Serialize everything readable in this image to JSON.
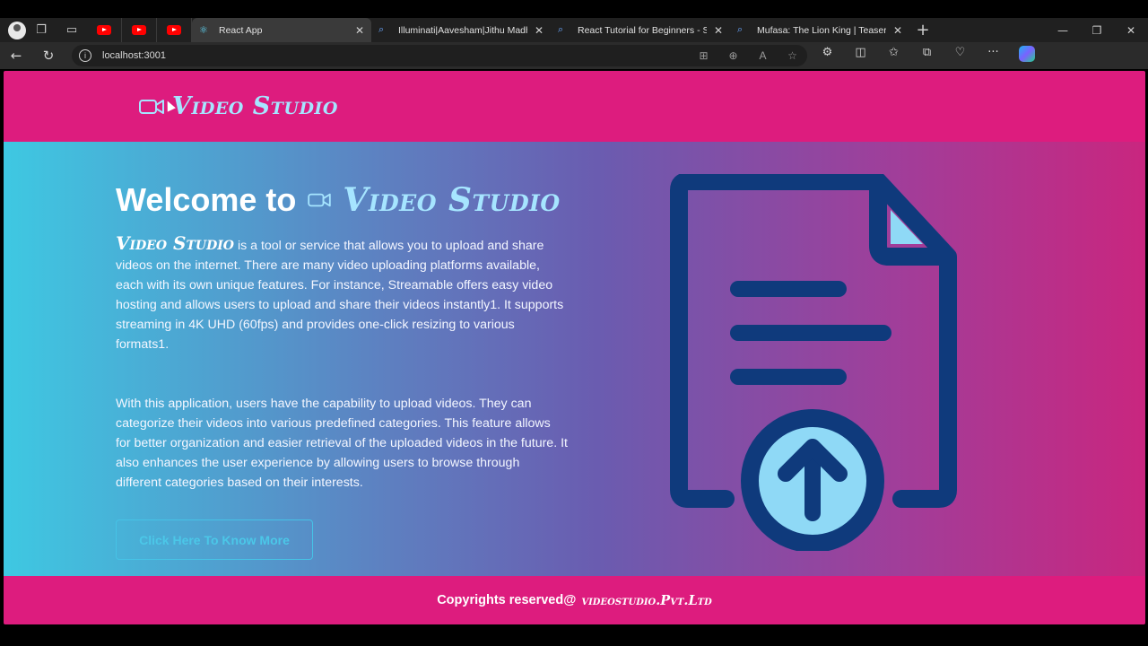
{
  "browser": {
    "tabs": [
      {
        "title": "React App",
        "active": true
      },
      {
        "title": "Illuminati|Aavesham|Jithu Madhavan",
        "active": false
      },
      {
        "title": "React Tutorial for Beginners - Search",
        "active": false
      },
      {
        "title": "Mufasa: The Lion King | Teaser Trailer",
        "active": false
      }
    ],
    "url": "localhost:3001"
  },
  "header": {
    "brand": "Video Studio"
  },
  "hero": {
    "welcome_prefix": "Welcome to",
    "brand": "Video Studio",
    "para1_brand": "Video Studio",
    "para1": " is a tool or service that allows you to upload and share videos on the internet. There are many video uploading platforms available, each with its own unique features. For instance, Streamable offers easy video hosting and allows users to upload and share their videos instantly1. It supports streaming in 4K UHD (60fps) and provides one-click resizing to various formats1.",
    "para2": "With this application, users have the capability to upload videos. They can categorize their videos into various predefined categories. This feature allows for better organization and easier retrieval of the uploaded videos in the future. It also enhances the user experience by allowing users to browse through different categories based on their interests.",
    "cta_label": "Click Here To Know More",
    "illustration": "file-upload-icon"
  },
  "footer": {
    "text": "Copyrights reserved@",
    "brand": "videostudio.Pvt.Ltd"
  },
  "colors": {
    "header_bg": "#dd1c7e",
    "brand": "#a6e5ff",
    "icon_dark": "#0f3a7c",
    "icon_light": "#8fd9f6"
  }
}
